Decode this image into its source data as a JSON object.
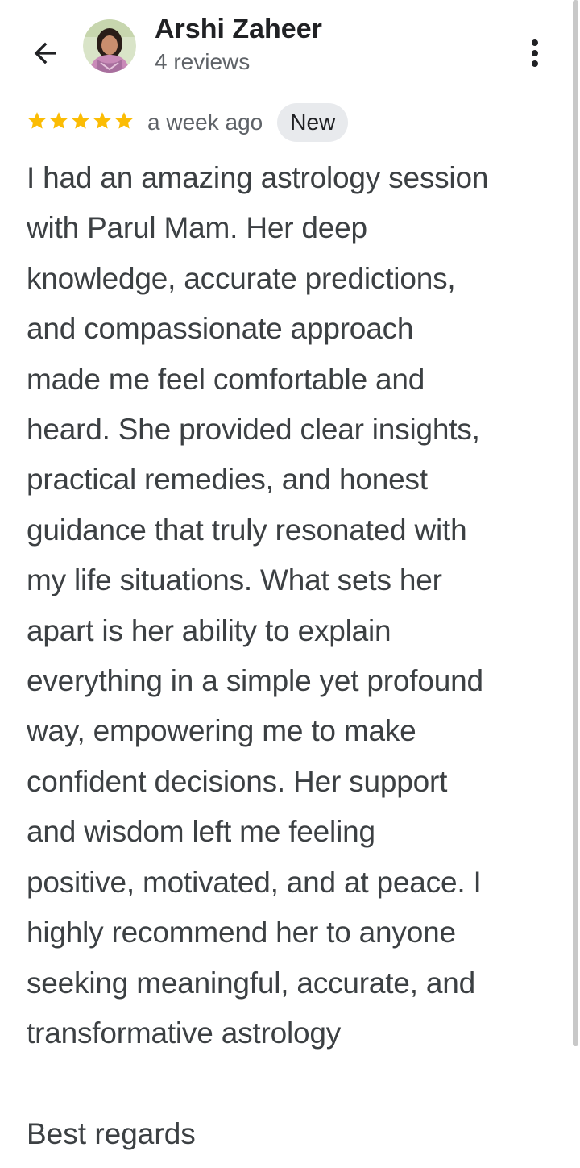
{
  "header": {
    "back_icon": "arrow-left-icon",
    "reviewer_name": "Arshi Zaheer",
    "review_count": "4 reviews",
    "more_icon": "more-vert-icon"
  },
  "review": {
    "rating": 5,
    "max_rating": 5,
    "star_color": "#fbbc04",
    "time_ago": "a week ago",
    "badge": "New",
    "body_lines": [
      "I had an amazing astrology session",
      "with Parul Mam. Her deep",
      "knowledge, accurate predictions,",
      "and compassionate approach",
      "made me feel comfortable and",
      "heard. She provided clear insights,",
      "practical remedies, and honest",
      "guidance that truly resonated with",
      "my life situations. What sets her",
      "apart is her ability to explain",
      "everything in a simple yet profound",
      "way, empowering me to make",
      "confident decisions. Her support",
      "and wisdom left me feeling",
      "positive, motivated, and at peace. I",
      "highly recommend her to anyone",
      "seeking meaningful, accurate, and",
      "transformative astrology"
    ],
    "signoff": "Best regards"
  }
}
